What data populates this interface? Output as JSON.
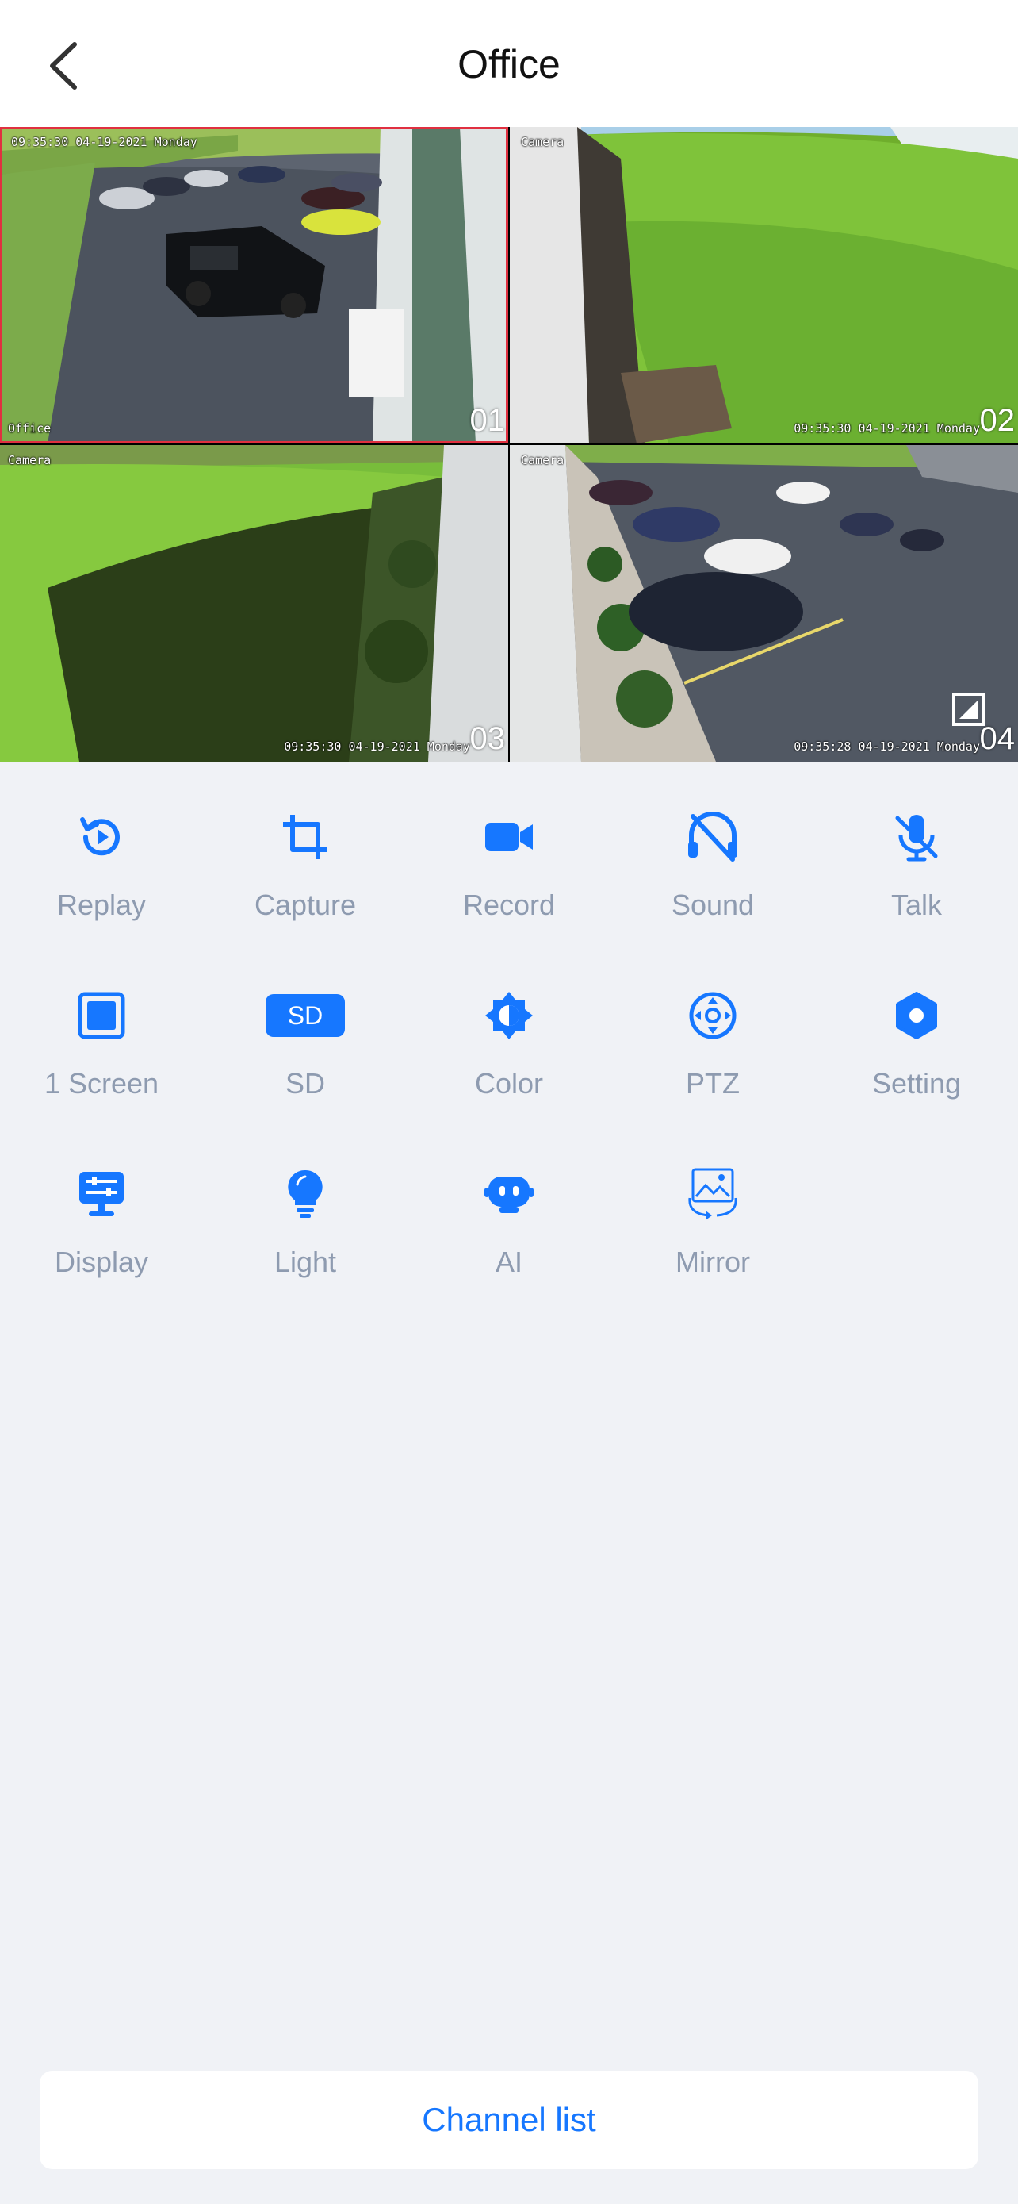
{
  "header": {
    "title": "Office"
  },
  "cameras": [
    {
      "number": "01",
      "osd_top": "09:35:30 04-19-2021 Monday",
      "osd_bottom": "Office",
      "selected": true
    },
    {
      "number": "02",
      "osd_top": "Camera",
      "osd_bottom": "09:35:30 04-19-2021 Monday"
    },
    {
      "number": "03",
      "osd_top": "Camera",
      "osd_bottom": "09:35:30 04-19-2021 Monday"
    },
    {
      "number": "04",
      "osd_top": "Camera",
      "osd_bottom": "09:35:28 04-19-2021 Monday"
    }
  ],
  "controls": [
    {
      "label": "Replay",
      "icon": "replay-icon"
    },
    {
      "label": "Capture",
      "icon": "crop-icon"
    },
    {
      "label": "Record",
      "icon": "video-camera-icon"
    },
    {
      "label": "Sound",
      "icon": "sound-off-icon"
    },
    {
      "label": "Talk",
      "icon": "mic-off-icon"
    },
    {
      "label": "1 Screen",
      "icon": "single-screen-icon"
    },
    {
      "label": "SD",
      "icon": "sd-icon",
      "badge": "SD"
    },
    {
      "label": "Color",
      "icon": "brightness-icon"
    },
    {
      "label": "PTZ",
      "icon": "ptz-icon"
    },
    {
      "label": "Setting",
      "icon": "gear-icon"
    },
    {
      "label": "Display",
      "icon": "display-settings-icon"
    },
    {
      "label": "Light",
      "icon": "lightbulb-icon"
    },
    {
      "label": "AI",
      "icon": "ai-robot-icon"
    },
    {
      "label": "Mirror",
      "icon": "mirror-icon"
    }
  ],
  "footer": {
    "channel_list_label": "Channel list"
  },
  "colors": {
    "accent": "#1677ff",
    "label": "#8e9bb0",
    "background": "#f0f2f6",
    "selected_border": "#e03040"
  }
}
